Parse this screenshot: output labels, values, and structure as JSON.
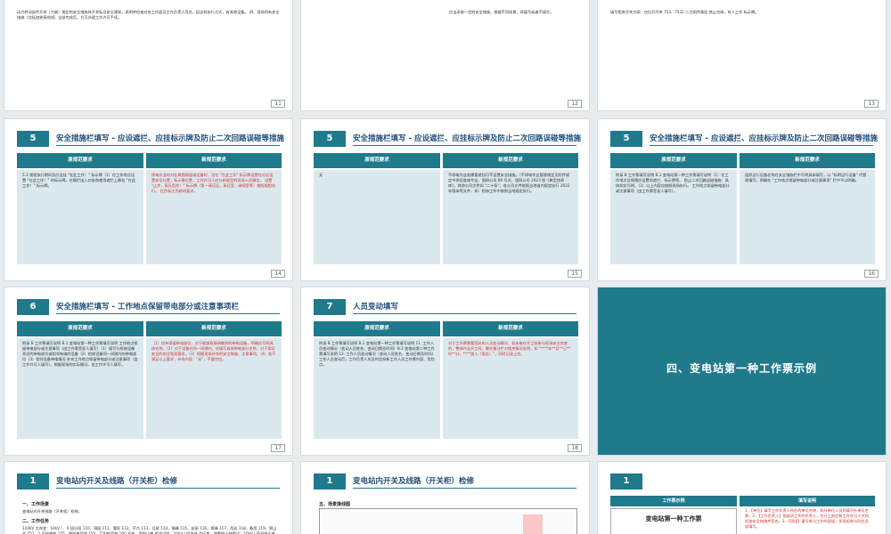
{
  "slides": [
    {
      "id": "s11",
      "num": "11",
      "body": "动力转动部件开关（刀闸）指定的安全措施持开关标及安全通知，表明并检查对各工作面及工作负责人签名，因这样执行方式，有其他设备。 四、现场所有安全措施（包括加装接地线）全部完成后，方可办理工作许可手续。"
    },
    {
      "id": "s12",
      "num": "12",
      "body": "应当采取一定的安全措施，根据不同场景，再填写或者不填写。"
    },
    {
      "id": "s13",
      "num": "13",
      "body": "填写相关开关刀闸：应拉开开关 753、7532 二刀闸并悬挂 禁止合闸，有人工作 标示牌。"
    },
    {
      "id": "s14",
      "num": "14",
      "num_label": "5",
      "title": "安全措施栏填写 - 应设遮拦、应挂标示牌及防止二次回路误碰等措施",
      "col_left": "原规范要求",
      "col_right": "新规范要求",
      "left_body": "5.3 规程执行期间及应设挂 \"在此工作！\" 标示牌（1）在工作地点设置 \"在此工作！\" 的标示牌。在隔栏出入口处和使用遮拦上悬挂 \"在此工作！\" 标示牌。",
      "right_body": "停电作业时对在周围保留电设备时，设在 \"在此工作\" 标示牌设置在对应设置安全位置，标示需位置，工作许可人应与新规定的现场人员确定。 设置 \"止步，高压危险！\" 标示牌（第一高压区，高压室，继保室等）按照规程执行。 红色标注为新的要求。"
    },
    {
      "id": "s15",
      "num": "15",
      "num_label": "5",
      "title": "安全措施栏填写 - 应设遮拦、应挂标示牌及防止二次回路误碰等措施",
      "col_left": "原规范要求",
      "col_right": "新规范要求",
      "left_body": "无",
      "right_body": "不停电作业若需要遮挡可不设置安全措施。（不停电作业管理规定见附件规定中承担变电专业，国网公司 89 号文，国网公司 2023 版《典型违章库》，其他公司文件如 \"二十条\"，各公司文件按照当地省内规定执行 2022 年版本等文件，如：检修工作中按照当地规定执行。"
    },
    {
      "id": "s16",
      "num": "16",
      "num_label": "5",
      "title": "安全措施栏填写 - 应设遮拦、应挂标示牌及防止二次回路误碰等措施",
      "col_left": "原规范要求",
      "col_right": "新规范要求",
      "left_body": "附录 B 工作票填写说明 B.1 变电站第一种工作票填写说明（1）在工作地点及周围应设置的遮拦、标示牌等。 防止二次回路误碰措施：具体如实写明。（2）以上内容应按照现场执行。 工作地点保留带电部分或注意事项（由工作票签发人填写）。",
      "right_body": "组织运行设备名称在安全措施栏中写明具体填写，以 \"标明运行设备\" 代替原填写，明确在 \"工作地点保留带电部分或注意事项\" 栏中予以明确。"
    },
    {
      "id": "s17",
      "num": "17",
      "num_label": "6",
      "title": "安全措施栏填写 - 工作地点保留带电部分或注意事项栏",
      "col_left": "原规范要求",
      "col_right": "新规范要求",
      "left_body": "附录 B 工作票填写说明 B.1 变电站第一种工作票填写说明 工作地点保留带电部分或注意事项（由工作票签发人填写）（1）填写与检修设备邻近的带电部位或相邻有电的设备（2）检修设备同一间隔内的带电部位（3）相邻设备带电情况 补充工作地点保留带电部分或注意事项（由工作许可人填写）。根据现场的实际情况，由工作许可人填写。",
      "right_body": "（1）应有保留带电部位，对于能够直接接触到的带电设备，明确应写明具体名称。（2）对于设备在同一间隔内，应填写具体带电部分名称，对于保证安全的安全距离要求。（3）根据现场补充的安全措施，注意事项。（4）若不满足以上要求，补充内容：\"无\"，不要空白。"
    },
    {
      "id": "s18",
      "num": "18",
      "num_label": "7",
      "title": "人员变动填写",
      "col_left": "原规范要求",
      "col_right": "新规范要求",
      "left_body": "附录 B 工作票填写说明 B.1 变电站第一种工作票填写说明 11. 工作人员变动情况（变动人员姓名、变动日期及时间）B.2 变电站第二种工作票填写说明 13. 工作人员变动情况（变动人员姓名、变动日期及时间）工作人员变动后，工作负责人应及时告知新工作人员工作票内容、危险点。",
      "right_body": "对于工作票需要签名的人员变动情况，如未能在开工前参与现场安全交底的，整体作业开工时，需在备注栏对相关情况说明，如 \"****年**月**日**时**分，****加入（离去）\"，同时记录上交。"
    },
    {
      "id": "s19",
      "big_title": "四、变电站第一种工作票示例"
    },
    {
      "id": "s20",
      "num_label": "1",
      "title": "变电站内开关及线路（开关柜）检修",
      "sub1": "一、工作场景",
      "sub1_text": "变电站内开关线路（开关柜）检修。",
      "sub2": "二、工作任务",
      "sub2_text": "110kV 尤岸变：10kV I 、II 段分段 110，洞园 111，惠旺 112，茫古 113，月星 114，镇峰 115，安丽 116，青峰 117，西岩 118，备用 119，周山开 151，1 号接地变 155，甲阳电容器 150，乙阳电容器 160 开关。洞里小峰 电流试验。10kV I 段母线 及压变，避雷器小修预试；10kV I 段母线压变 1015，避雷器 1014 间隔开关大修。"
    },
    {
      "id": "s21",
      "num_label": "1",
      "title": "变电站内开关及线路（开关柜）检修",
      "sub": "五、场景接线图"
    },
    {
      "id": "s22",
      "num_label": "1",
      "col_left": "工作票示例",
      "col_right": "填写说明",
      "ticket_title": "变电站第一种工作票",
      "explain": "1、【单位】填写工作负责人所在的单位名称，如外单位人员则填写外单位名称。2、【工作负责人】指该项工作的负责人，在开工前应和工作许可人共同检查安全措施并签名。3、【班组】填写参与工作的班组，多班组参与时应全部填写。"
    }
  ]
}
